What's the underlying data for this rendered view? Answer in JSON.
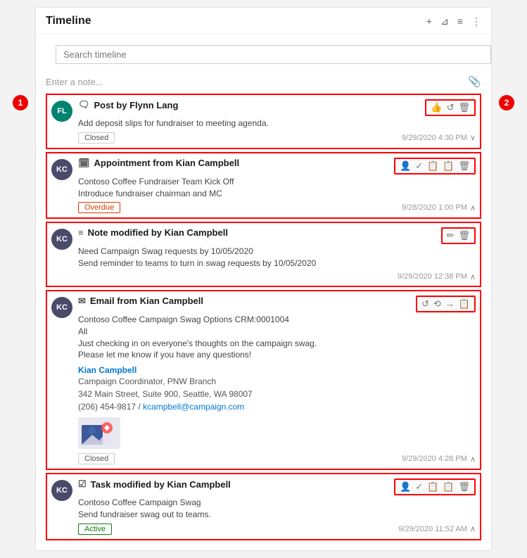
{
  "header": {
    "title": "Timeline",
    "add_icon": "+",
    "filter_icon": "⊿",
    "sort_icon": "≡",
    "more_icon": "⋮"
  },
  "search": {
    "placeholder": "Search timeline"
  },
  "note_entry": {
    "label": "Enter a note..."
  },
  "items": [
    {
      "id": "post-1",
      "avatar_initials": "FL",
      "avatar_color": "teal",
      "type_icon": "post",
      "title": "Post by Flynn Lang",
      "body": "Add deposit slips for fundraiser to meeting agenda.",
      "badge": "Closed",
      "badge_type": "closed",
      "timestamp": "9/29/2020 4:30 PM",
      "chevron": "∨",
      "actions": [
        "👍",
        "↺",
        "🗑"
      ]
    },
    {
      "id": "appt-1",
      "avatar_initials": "KC",
      "avatar_color": "dark",
      "type_icon": "calendar",
      "title": "Appointment from Kian Campbell",
      "body": "Contoso Coffee Fundraiser Team Kick Off\nIntroduce fundraiser chairman and MC",
      "badge": "Overdue",
      "badge_type": "overdue",
      "timestamp": "9/28/2020 1:00 PM",
      "chevron": "∧",
      "actions": [
        "👤",
        "✓",
        "📋",
        "📋",
        "🗑"
      ]
    },
    {
      "id": "note-1",
      "avatar_initials": "KC",
      "avatar_color": "dark",
      "type_icon": "note",
      "title": "Note modified by Kian Campbell",
      "body": "Need Campaign Swag requests by 10/05/2020\nSend reminder to teams to turn in swag requests by 10/05/2020",
      "badge": null,
      "timestamp": "9/29/2020 12:38 PM",
      "chevron": "∧",
      "actions": [
        "✏",
        "🗑"
      ]
    },
    {
      "id": "email-1",
      "avatar_initials": "KC",
      "avatar_color": "dark",
      "type_icon": "email",
      "title": "Email from Kian Campbell",
      "body": "Contoso Coffee Campaign Swag Options CRM:0001004\nAll\nJust checking in on everyone's thoughts on the campaign swag.\nPlease let me know if you have any questions!",
      "sig_name": "Kian Campbell",
      "sig_role": "Campaign Coordinator, PNW Branch",
      "sig_address": "342 Main Street, Suite 900, Seattle, WA 98007",
      "sig_phone": "(206) 454-9817",
      "sig_email": "kcampbell@campaign.com",
      "has_image": true,
      "badge": "Closed",
      "badge_type": "closed",
      "timestamp": "9/29/2020 4:28 PM",
      "chevron": "∧",
      "actions": [
        "↺",
        "↺↺",
        "→",
        "📋"
      ]
    },
    {
      "id": "task-1",
      "avatar_initials": "KC",
      "avatar_color": "dark",
      "type_icon": "task",
      "title": "Task modified by Kian Campbell",
      "body": "Contoso Coffee Campaign Swag\nSend fundraiser swag out to teams.",
      "badge": "Active",
      "badge_type": "active",
      "timestamp": "9/29/2020 11:52 AM",
      "chevron": "∧",
      "actions": [
        "👤",
        "✓",
        "📋",
        "📋",
        "🗑"
      ]
    }
  ]
}
